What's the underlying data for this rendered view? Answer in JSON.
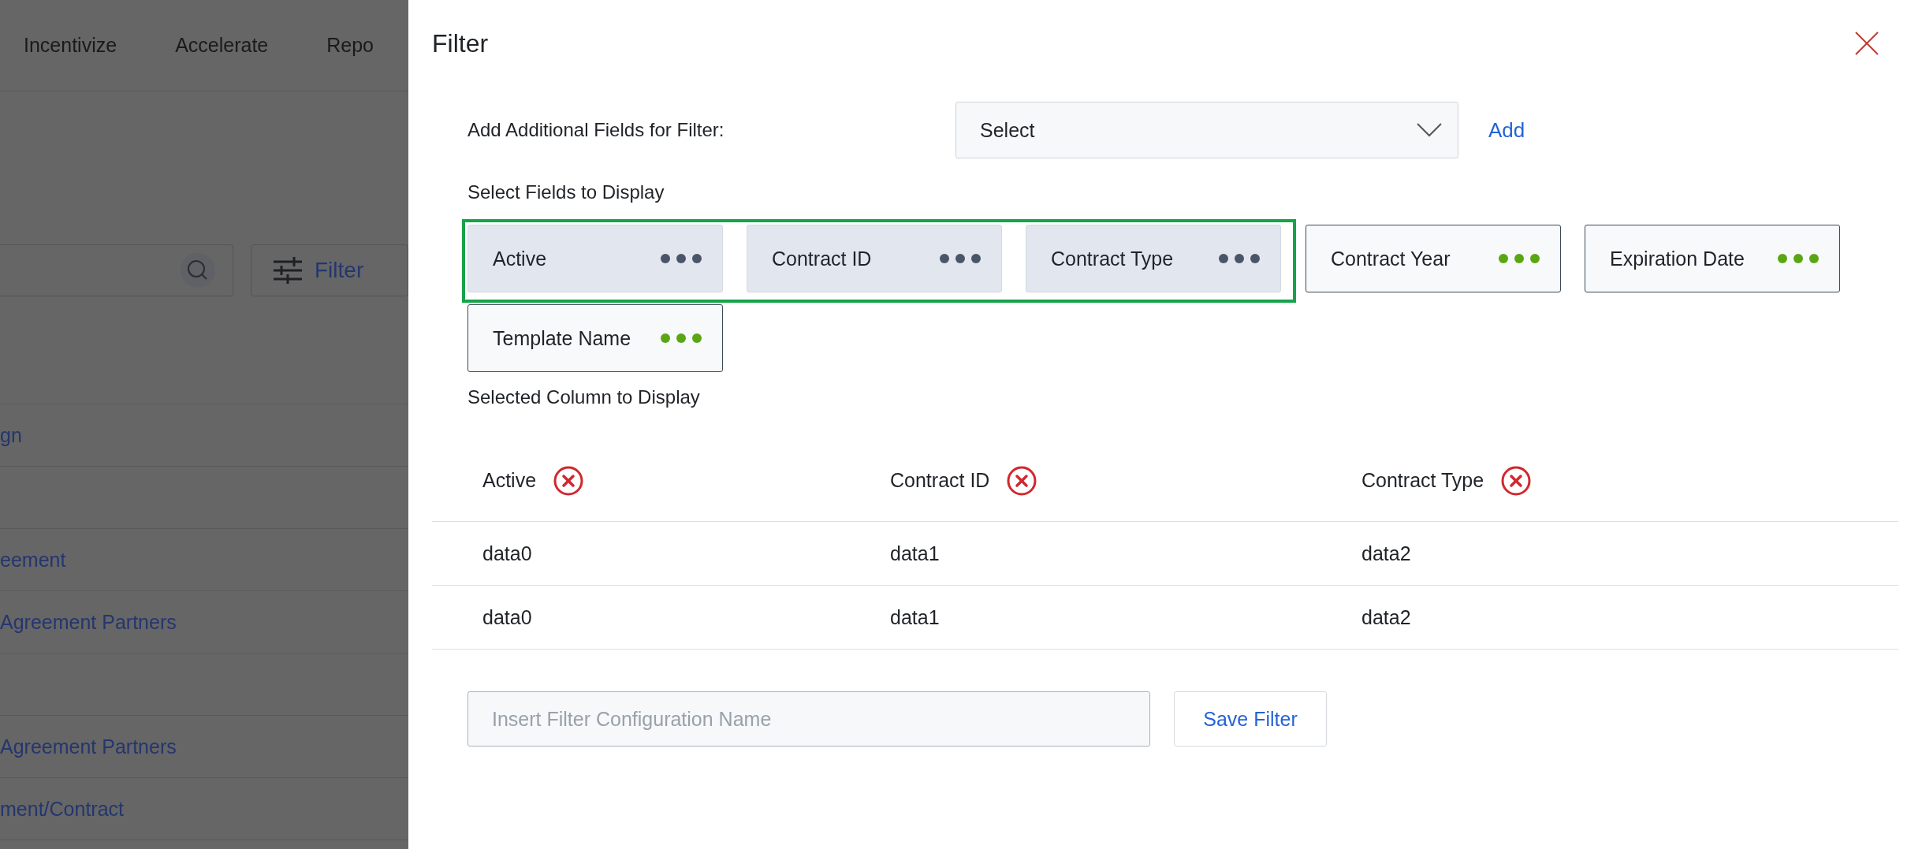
{
  "background": {
    "nav": [
      "Incentivize",
      "Accelerate",
      "Repo"
    ],
    "filter_button": "Filter",
    "rows": [
      {
        "link": "gn"
      },
      {},
      {
        "link": "eement"
      },
      {
        "link": "Agreement Partners"
      },
      {},
      {
        "link": "Agreement Partners"
      },
      {
        "link": "ment/Contract"
      }
    ]
  },
  "dialog": {
    "title": "Filter",
    "additional_fields": {
      "label": "Add Additional Fields for Filter:",
      "dropdown": "Select",
      "add_link": "Add"
    },
    "fields_heading": "Select Fields to Display",
    "fields": [
      {
        "label": "Active",
        "selected": true
      },
      {
        "label": "Contract ID",
        "selected": true
      },
      {
        "label": "Contract Type",
        "selected": true
      },
      {
        "label": "Contract Year",
        "selected": false
      },
      {
        "label": "Expiration Date",
        "selected": false
      },
      {
        "label": "Template Name",
        "selected": false
      }
    ],
    "columns_heading": "Selected Column to Display",
    "table": {
      "columns": [
        "Active",
        "Contract ID",
        "Contract Type"
      ],
      "rows": [
        [
          "data0",
          "data1",
          "data2"
        ],
        [
          "data0",
          "data1",
          "data2"
        ]
      ]
    },
    "name_field": {
      "placeholder": "Insert Filter Configuration Name"
    },
    "save_button": "Save Filter"
  }
}
